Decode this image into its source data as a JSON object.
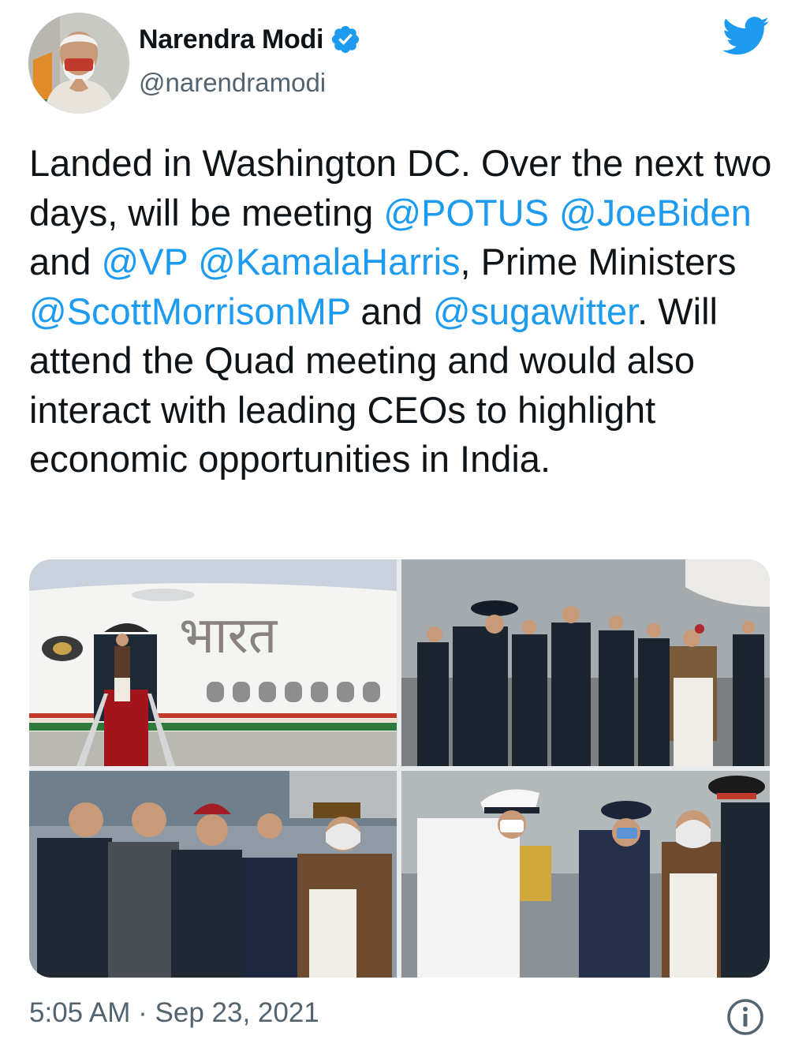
{
  "user": {
    "display_name": "Narendra Modi",
    "handle": "@narendramodi",
    "verified": true,
    "avatar_icon": "profile-photo"
  },
  "brand": {
    "icon": "twitter-bird-icon",
    "color": "#1d9bf0"
  },
  "tweet": {
    "segments": [
      {
        "text": "Landed in Washington DC. Over the next two days, will be meeting ",
        "link": false
      },
      {
        "text": "@POTUS",
        "link": true
      },
      {
        "text": " ",
        "link": false
      },
      {
        "text": "@JoeBiden",
        "link": true
      },
      {
        "text": " and ",
        "link": false
      },
      {
        "text": "@VP",
        "link": true
      },
      {
        "text": " ",
        "link": false
      },
      {
        "text": "@KamalaHarris",
        "link": true
      },
      {
        "text": ", Prime Ministers ",
        "link": false
      },
      {
        "text": "@ScottMorrisonMP",
        "link": true
      },
      {
        "text": " and ",
        "link": false
      },
      {
        "text": "@sugawitter",
        "link": true
      },
      {
        "text": ". Will attend the Quad meeting and would also interact with leading CEOs to highlight economic opportunities in India.",
        "link": false
      }
    ],
    "timestamp": "5:05 AM · Sep 23, 2021",
    "aircraft_lettering": "भारत"
  },
  "colors": {
    "text": "#0f1419",
    "secondary": "#536471",
    "link": "#1d9bf0"
  }
}
